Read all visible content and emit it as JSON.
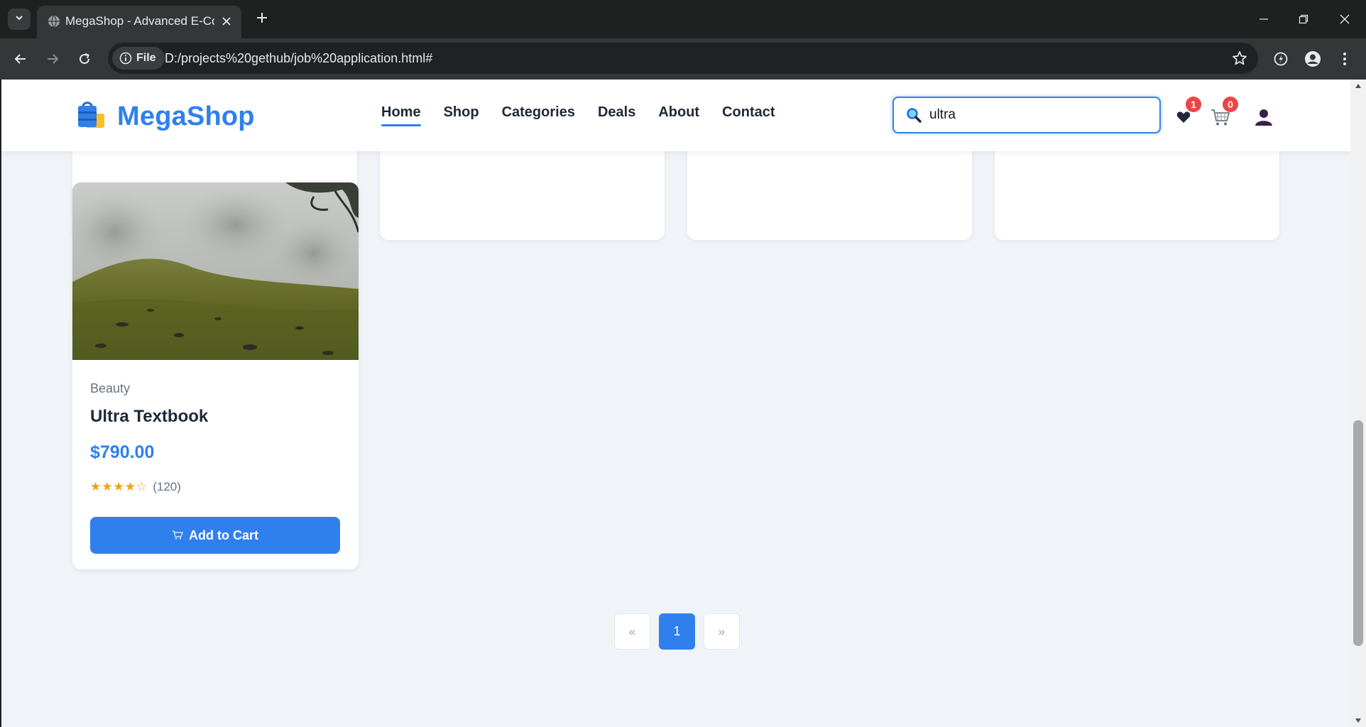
{
  "browser": {
    "tab_title": "MegaShop - Advanced E-Commerce",
    "address_chip": "File",
    "url": "D:/projects%20gethub/job%20application.html#"
  },
  "site": {
    "brand": "MegaShop",
    "nav": [
      {
        "label": "Home",
        "active": true
      },
      {
        "label": "Shop"
      },
      {
        "label": "Categories"
      },
      {
        "label": "Deals"
      },
      {
        "label": "About"
      },
      {
        "label": "Contact"
      }
    ],
    "search": {
      "value": "ultra"
    },
    "wishlist_count": "1",
    "cart_count": "0"
  },
  "product": {
    "category": "Beauty",
    "name": "Ultra Textbook",
    "price": "$790.00",
    "stars": "★★★★☆",
    "rating_value": 4,
    "review_count": "(120)",
    "button_label": "Add to Cart"
  },
  "pagination": {
    "prev": "«",
    "current": "1",
    "next": "»"
  },
  "colors": {
    "accent": "#2f80ed",
    "badge": "#ef4444",
    "star": "#f59e0b",
    "page_bg": "#f0f3f8"
  }
}
